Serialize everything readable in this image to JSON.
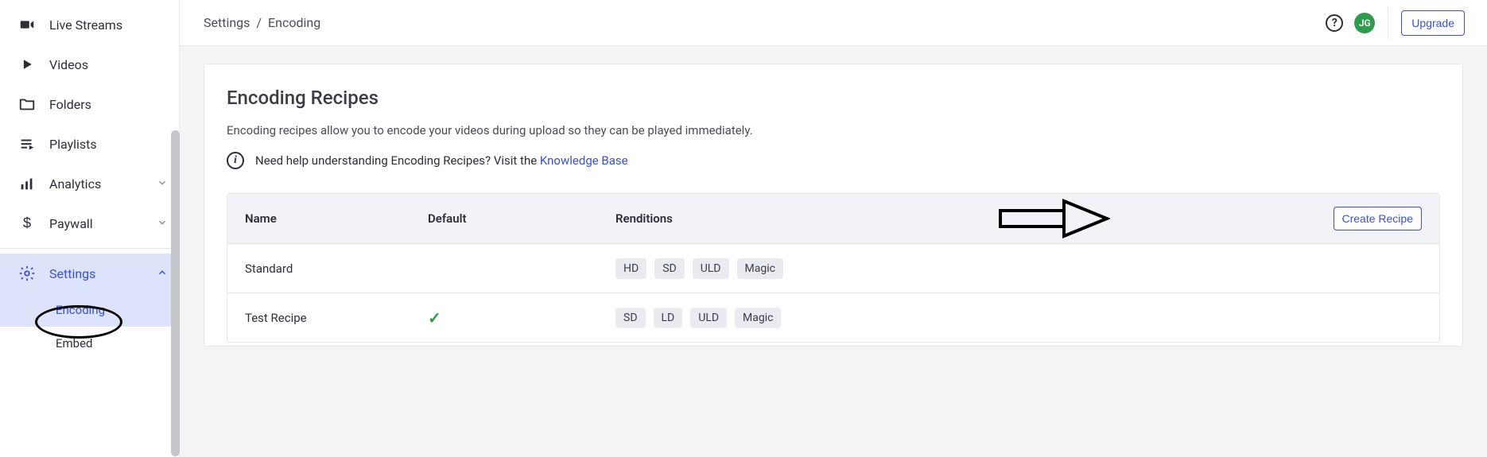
{
  "sidebar": {
    "items": [
      {
        "label": "Live Streams"
      },
      {
        "label": "Videos"
      },
      {
        "label": "Folders"
      },
      {
        "label": "Playlists"
      },
      {
        "label": "Analytics"
      },
      {
        "label": "Paywall"
      },
      {
        "label": "Settings"
      }
    ],
    "sub": {
      "encoding": "Encoding",
      "embed": "Embed"
    }
  },
  "topbar": {
    "breadcrumb_root": "Settings",
    "breadcrumb_sep": "/",
    "breadcrumb_current": "Encoding",
    "avatar_initials": "JG",
    "upgrade_label": "Upgrade"
  },
  "page": {
    "title": "Encoding Recipes",
    "description": "Encoding recipes allow you to encode your videos during upload so they can be played immediately.",
    "help_prefix": "Need help understanding Encoding Recipes? Visit the ",
    "help_link": "Knowledge Base"
  },
  "table": {
    "headers": {
      "name": "Name",
      "default": "Default",
      "renditions": "Renditions"
    },
    "create_label": "Create Recipe",
    "rows": [
      {
        "name": "Standard",
        "is_default": false,
        "renditions": [
          "HD",
          "SD",
          "ULD",
          "Magic"
        ]
      },
      {
        "name": "Test Recipe",
        "is_default": true,
        "renditions": [
          "SD",
          "LD",
          "ULD",
          "Magic"
        ]
      }
    ]
  }
}
